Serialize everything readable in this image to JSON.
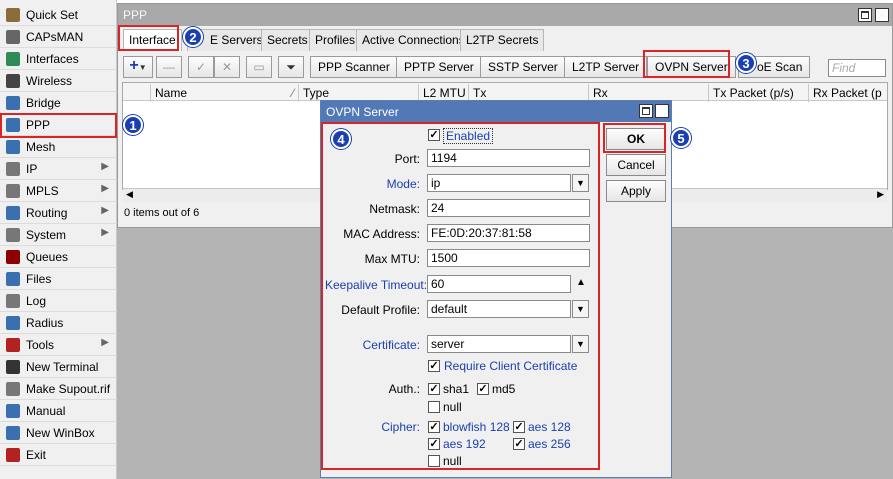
{
  "sidebar": {
    "items": [
      {
        "label": "Quick Set",
        "icon": "quick-set-icon",
        "color": "#8a6d3b",
        "arrow": false
      },
      {
        "label": "CAPsMAN",
        "icon": "capsman-icon",
        "color": "#666666",
        "arrow": false
      },
      {
        "label": "Interfaces",
        "icon": "interfaces-icon",
        "color": "#2e8b57",
        "arrow": false
      },
      {
        "label": "Wireless",
        "icon": "wireless-icon",
        "color": "#444444",
        "arrow": false
      },
      {
        "label": "Bridge",
        "icon": "bridge-icon",
        "color": "#3a6fb0",
        "arrow": false
      },
      {
        "label": "PPP",
        "icon": "ppp-icon",
        "color": "#3a6fb0",
        "arrow": false
      },
      {
        "label": "Mesh",
        "icon": "mesh-icon",
        "color": "#3a6fb0",
        "arrow": false
      },
      {
        "label": "IP",
        "icon": "ip-icon",
        "color": "#777777",
        "arrow": true
      },
      {
        "label": "MPLS",
        "icon": "mpls-icon",
        "color": "#777777",
        "arrow": true
      },
      {
        "label": "Routing",
        "icon": "routing-icon",
        "color": "#3a6fb0",
        "arrow": true
      },
      {
        "label": "System",
        "icon": "system-icon",
        "color": "#777777",
        "arrow": true
      },
      {
        "label": "Queues",
        "icon": "queues-icon",
        "color": "#8b0000",
        "arrow": false
      },
      {
        "label": "Files",
        "icon": "files-icon",
        "color": "#3a6fb0",
        "arrow": false
      },
      {
        "label": "Log",
        "icon": "log-icon",
        "color": "#777777",
        "arrow": false
      },
      {
        "label": "Radius",
        "icon": "radius-icon",
        "color": "#3a6fb0",
        "arrow": false
      },
      {
        "label": "Tools",
        "icon": "tools-icon",
        "color": "#b22222",
        "arrow": true
      },
      {
        "label": "New Terminal",
        "icon": "terminal-icon",
        "color": "#333333",
        "arrow": false
      },
      {
        "label": "Make Supout.rif",
        "icon": "supout-icon",
        "color": "#777777",
        "arrow": false
      },
      {
        "label": "Manual",
        "icon": "manual-icon",
        "color": "#3a6fb0",
        "arrow": false
      },
      {
        "label": "New WinBox",
        "icon": "winbox-icon",
        "color": "#3a6fb0",
        "arrow": false
      },
      {
        "label": "Exit",
        "icon": "exit-icon",
        "color": "#b22222",
        "arrow": false
      }
    ]
  },
  "ppp": {
    "title": "PPP",
    "tabs": [
      "Interface",
      "PPPoE Servers",
      "Secrets",
      "Profiles",
      "Active Connections",
      "L2TP Secrets"
    ],
    "tab_interface_label": "Interface",
    "tab_pppoe_visible": "E Servers",
    "toolbar": {
      "ppp_scanner": "PPP Scanner",
      "pptp_server": "PPTP Server",
      "sstp_server": "SSTP Server",
      "l2tp_server": "L2TP Server",
      "ovpn_server": "OVPN Server",
      "pppoe_scan_visible": "oE Scan",
      "find_placeholder": "Find"
    },
    "columns": [
      "Name",
      "Type",
      "L2 MTU",
      "Tx",
      "Rx",
      "Tx Packet (p/s)",
      "Rx Packet (p"
    ],
    "status": "0 items out of 6"
  },
  "dialog": {
    "title": "OVPN Server",
    "enabled_label": "Enabled",
    "enabled": true,
    "port_label": "Port:",
    "port": "1194",
    "mode_label": "Mode:",
    "mode": "ip",
    "netmask_label": "Netmask:",
    "netmask": "24",
    "mac_label": "MAC Address:",
    "mac": "FE:0D:20:37:81:58",
    "mtu_label": "Max MTU:",
    "mtu": "1500",
    "keepalive_label": "Keepalive Timeout:",
    "keepalive": "60",
    "profile_label": "Default Profile:",
    "profile": "default",
    "certificate_label": "Certificate:",
    "certificate": "server",
    "require_cert_label": "Require Client Certificate",
    "auth_label": "Auth.:",
    "auth": {
      "sha1": "sha1",
      "md5": "md5",
      "null": "null"
    },
    "cipher_label": "Cipher:",
    "cipher": {
      "blowfish": "blowfish 128",
      "aes128": "aes 128",
      "aes192": "aes 192",
      "aes256": "aes 256",
      "null": "null"
    },
    "ok": "OK",
    "cancel": "Cancel",
    "apply": "Apply"
  },
  "annotations": [
    "1",
    "2",
    "3",
    "4",
    "5"
  ],
  "colors": {
    "highlight": "#d92525",
    "badge": "#1a3fb0",
    "dialog_title": "#5278b6",
    "link_blue": "#1a3fb0"
  }
}
